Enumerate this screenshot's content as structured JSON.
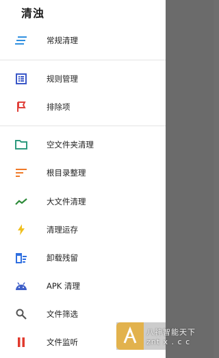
{
  "drawer": {
    "title": "清浊",
    "items": [
      {
        "label": "常规清理",
        "icon": "list-lines-icon",
        "color": "#2f8fe0"
      },
      {
        "label": "规则管理",
        "icon": "list-box-icon",
        "color": "#3b58c8"
      },
      {
        "label": "排除项",
        "icon": "flag-icon",
        "color": "#e0403a"
      },
      {
        "label": "空文件夹清理",
        "icon": "folder-icon",
        "color": "#2e9a7e"
      },
      {
        "label": "根目录整理",
        "icon": "sort-lines-icon",
        "color": "#f07a28"
      },
      {
        "label": "大文件清理",
        "icon": "trend-line-icon",
        "color": "#2e8b3a"
      },
      {
        "label": "清理运存",
        "icon": "bolt-icon",
        "color": "#f0c020"
      },
      {
        "label": "卸载残留",
        "icon": "trash-list-icon",
        "color": "#2f6fe0"
      },
      {
        "label": "APK 清理",
        "icon": "android-icon",
        "color": "#3f5fc8"
      },
      {
        "label": "文件筛选",
        "icon": "search-icon",
        "color": "#555555"
      },
      {
        "label": "文件监听",
        "icon": "pause-icon",
        "color": "#e03a2e"
      }
    ]
  },
  "watermark": {
    "line1": "八神智能天下",
    "line2": "znt x . c c"
  }
}
